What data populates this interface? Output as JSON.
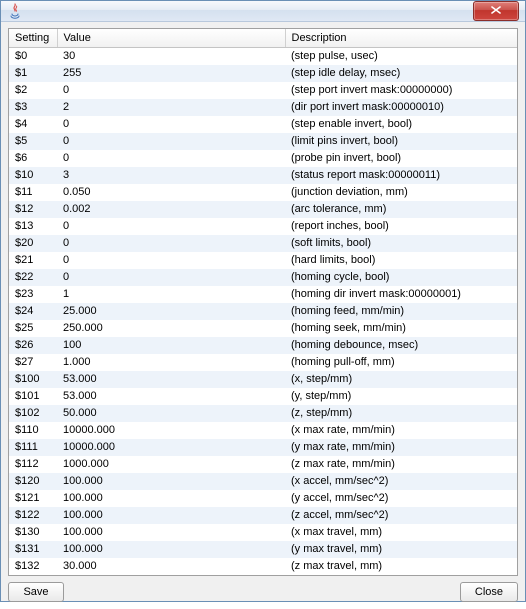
{
  "window": {
    "title": ""
  },
  "columns": {
    "setting": "Setting",
    "value": "Value",
    "description": "Description"
  },
  "rows": [
    {
      "setting": "$0",
      "value": "30",
      "description": "(step pulse, usec)"
    },
    {
      "setting": "$1",
      "value": "255",
      "description": "(step idle delay, msec)"
    },
    {
      "setting": "$2",
      "value": "0",
      "description": "(step port invert mask:00000000)"
    },
    {
      "setting": "$3",
      "value": "2",
      "description": "(dir port invert mask:00000010)"
    },
    {
      "setting": "$4",
      "value": "0",
      "description": "(step enable invert, bool)"
    },
    {
      "setting": "$5",
      "value": "0",
      "description": "(limit pins invert, bool)"
    },
    {
      "setting": "$6",
      "value": "0",
      "description": "(probe pin invert, bool)"
    },
    {
      "setting": "$10",
      "value": "3",
      "description": "(status report mask:00000011)"
    },
    {
      "setting": "$11",
      "value": "0.050",
      "description": "(junction deviation, mm)"
    },
    {
      "setting": "$12",
      "value": "0.002",
      "description": "(arc tolerance, mm)"
    },
    {
      "setting": "$13",
      "value": "0",
      "description": "(report inches, bool)"
    },
    {
      "setting": "$20",
      "value": "0",
      "description": "(soft limits, bool)"
    },
    {
      "setting": "$21",
      "value": "0",
      "description": "(hard limits, bool)"
    },
    {
      "setting": "$22",
      "value": "0",
      "description": "(homing cycle, bool)"
    },
    {
      "setting": "$23",
      "value": "1",
      "description": "(homing dir invert mask:00000001)"
    },
    {
      "setting": "$24",
      "value": "25.000",
      "description": "(homing feed, mm/min)"
    },
    {
      "setting": "$25",
      "value": "250.000",
      "description": "(homing seek, mm/min)"
    },
    {
      "setting": "$26",
      "value": "100",
      "description": "(homing debounce, msec)"
    },
    {
      "setting": "$27",
      "value": "1.000",
      "description": "(homing pull-off, mm)"
    },
    {
      "setting": "$100",
      "value": "53.000",
      "description": "(x, step/mm)"
    },
    {
      "setting": "$101",
      "value": "53.000",
      "description": "(y, step/mm)"
    },
    {
      "setting": "$102",
      "value": "50.000",
      "description": "(z, step/mm)"
    },
    {
      "setting": "$110",
      "value": "10000.000",
      "description": "(x max rate, mm/min)"
    },
    {
      "setting": "$111",
      "value": "10000.000",
      "description": "(y max rate, mm/min)"
    },
    {
      "setting": "$112",
      "value": "1000.000",
      "description": "(z max rate, mm/min)"
    },
    {
      "setting": "$120",
      "value": "100.000",
      "description": "(x accel, mm/sec^2)"
    },
    {
      "setting": "$121",
      "value": "100.000",
      "description": "(y accel, mm/sec^2)"
    },
    {
      "setting": "$122",
      "value": "100.000",
      "description": "(z accel, mm/sec^2)"
    },
    {
      "setting": "$130",
      "value": "100.000",
      "description": "(x max travel, mm)"
    },
    {
      "setting": "$131",
      "value": "100.000",
      "description": "(y max travel, mm)"
    },
    {
      "setting": "$132",
      "value": "30.000",
      "description": "(z max travel, mm)"
    }
  ],
  "buttons": {
    "save": "Save",
    "close": "Close"
  }
}
